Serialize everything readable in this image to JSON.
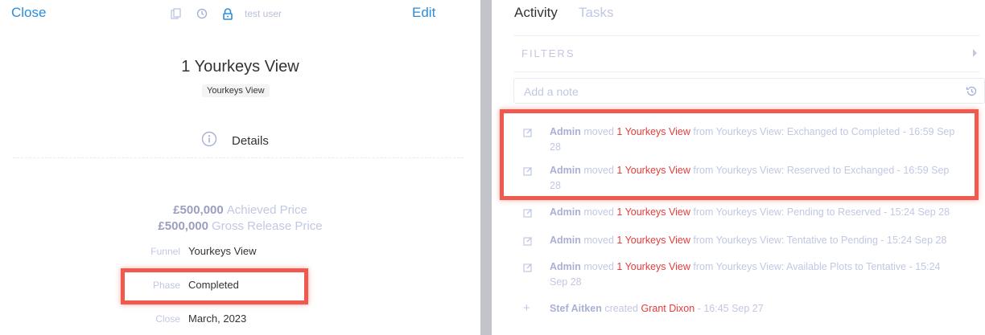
{
  "left": {
    "close_label": "Close",
    "edit_label": "Edit",
    "user_label": "test user",
    "title": "1 Yourkeys View",
    "tag": "Yourkeys View",
    "details_label": "Details",
    "achieved_amount": "£500,000",
    "achieved_label": "Achieved Price",
    "gross_amount": "£500,000",
    "gross_label": "Gross Release Price",
    "fields": [
      {
        "key": "Funnel",
        "value": "Yourkeys View"
      },
      {
        "key": "Phase",
        "value": "Completed"
      },
      {
        "key": "Close",
        "value": "March, 2023"
      }
    ]
  },
  "right": {
    "tabs": [
      "Activity",
      "Tasks"
    ],
    "filters_label": "FILTERS",
    "note_placeholder": "Add a note",
    "activities": [
      {
        "icon": "edit-icon",
        "who": "Admin",
        "verb": "moved",
        "target": "1 Yourkeys View",
        "rest": "from Yourkeys View: Exchanged to Completed - 16:59 Sep 28"
      },
      {
        "icon": "edit-icon",
        "who": "Admin",
        "verb": "moved",
        "target": "1 Yourkeys View",
        "rest": "from Yourkeys View: Reserved to Exchanged - 16:59 Sep 28"
      },
      {
        "icon": "edit-icon",
        "who": "Admin",
        "verb": "moved",
        "target": "1 Yourkeys View",
        "rest": "from Yourkeys View: Pending to Reserved - 15:24 Sep 28"
      },
      {
        "icon": "edit-icon",
        "who": "Admin",
        "verb": "moved",
        "target": "1 Yourkeys View",
        "rest": "from Yourkeys View: Tentative to Pending - 15:24 Sep 28"
      },
      {
        "icon": "edit-icon",
        "who": "Admin",
        "verb": "moved",
        "target": "1 Yourkeys View",
        "rest": "from Yourkeys View: Available Plots to Tentative - 15:24 Sep 28"
      },
      {
        "icon": "plus-icon",
        "who": "Stef Aitken",
        "verb": "created",
        "target": "Grant Dixon",
        "rest": "- 16:45 Sep 27"
      }
    ]
  },
  "colors": {
    "accent": "#2a8ddb",
    "highlight": "#f05a4e",
    "link_red": "#e43b3b",
    "muted": "#c2c7e3"
  },
  "icons": [
    "copy-icon",
    "history-icon",
    "lock-icon",
    "info-icon",
    "history-icon",
    "edit-icon",
    "plus-icon"
  ]
}
